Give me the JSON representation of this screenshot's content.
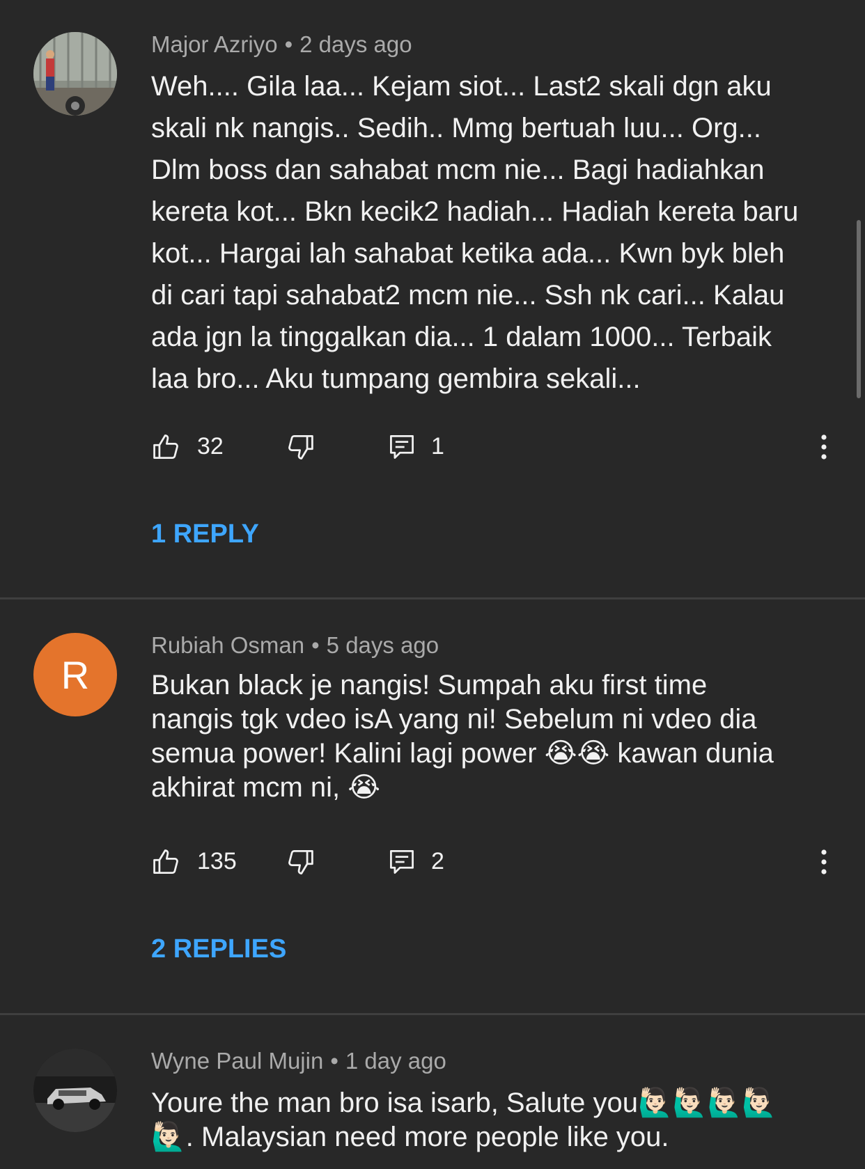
{
  "comments": [
    {
      "author": "Major Azriyo",
      "time": "2 days ago",
      "text": "Weh.... Gila laa... Kejam siot... Last2 skali dgn aku\nskali nk nangis.. Sedih.. Mmg bertuah luu... Org...\nDlm boss dan sahabat mcm nie... Bagi hadiahkan\nkereta kot... Bkn kecik2 hadiah... Hadiah kereta baru\nkot... Hargai lah sahabat ketika ada... Kwn byk bleh\ndi cari tapi sahabat2 mcm nie... Ssh nk cari... Kalau\nada jgn la tinggalkan dia...  1 dalam 1000... Terbaik\nlaa bro... Aku tumpang gembira sekali...",
      "likes": "32",
      "reply_count": "1",
      "replies_label": "1 REPLY"
    },
    {
      "author": "Rubiah Osman",
      "avatar_letter": "R",
      "time": "5 days ago",
      "text": "Bukan black je nangis!  Sumpah aku first time\nnangis tgk vdeo isA yang ni!  Sebelum ni vdeo dia\nsemua power!  Kalini lagi power 😭😭 kawan dunia\nakhirat mcm ni, 😭",
      "likes": "135",
      "reply_count": "2",
      "replies_label": "2 REPLIES"
    },
    {
      "author": "Wyne Paul Mujin",
      "time": "1 day ago",
      "text": "Youre the man bro isa isarb, Salute you🙋🏻‍♂️🙋🏻‍♂️🙋🏻‍♂️🙋🏻‍♂️\n🙋🏻‍♂️. Malaysian need more people like you."
    }
  ],
  "separator": "•",
  "icons": {
    "like": "thumbs-up-icon",
    "dislike": "thumbs-down-icon",
    "reply": "comment-reply-icon",
    "more": "more-vertical-icon"
  },
  "colors": {
    "background": "#282828",
    "link": "#3ea6ff",
    "meta": "#aaaaaa",
    "avatar_r": "#e4742c"
  }
}
